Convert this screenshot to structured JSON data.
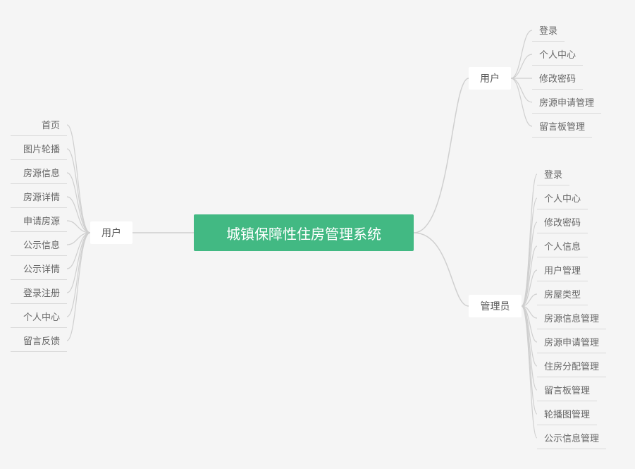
{
  "root": {
    "title": "城镇保障性住房管理系统"
  },
  "leftBranch": {
    "label": "用户",
    "items": [
      "首页",
      "图片轮播",
      "房源信息",
      "房源详情",
      "申请房源",
      "公示信息",
      "公示详情",
      "登录注册",
      "个人中心",
      "留言反馈"
    ]
  },
  "rightTopBranch": {
    "label": "用户",
    "items": [
      "登录",
      "个人中心",
      "修改密码",
      "房源申请管理",
      "留言板管理"
    ]
  },
  "rightBottomBranch": {
    "label": "管理员",
    "items": [
      "登录",
      "个人中心",
      "修改密码",
      "个人信息",
      "用户管理",
      "房屋类型",
      "房源信息管理",
      "房源申请管理",
      "住房分配管理",
      "留言板管理",
      "轮播图管理",
      "公示信息管理"
    ]
  }
}
